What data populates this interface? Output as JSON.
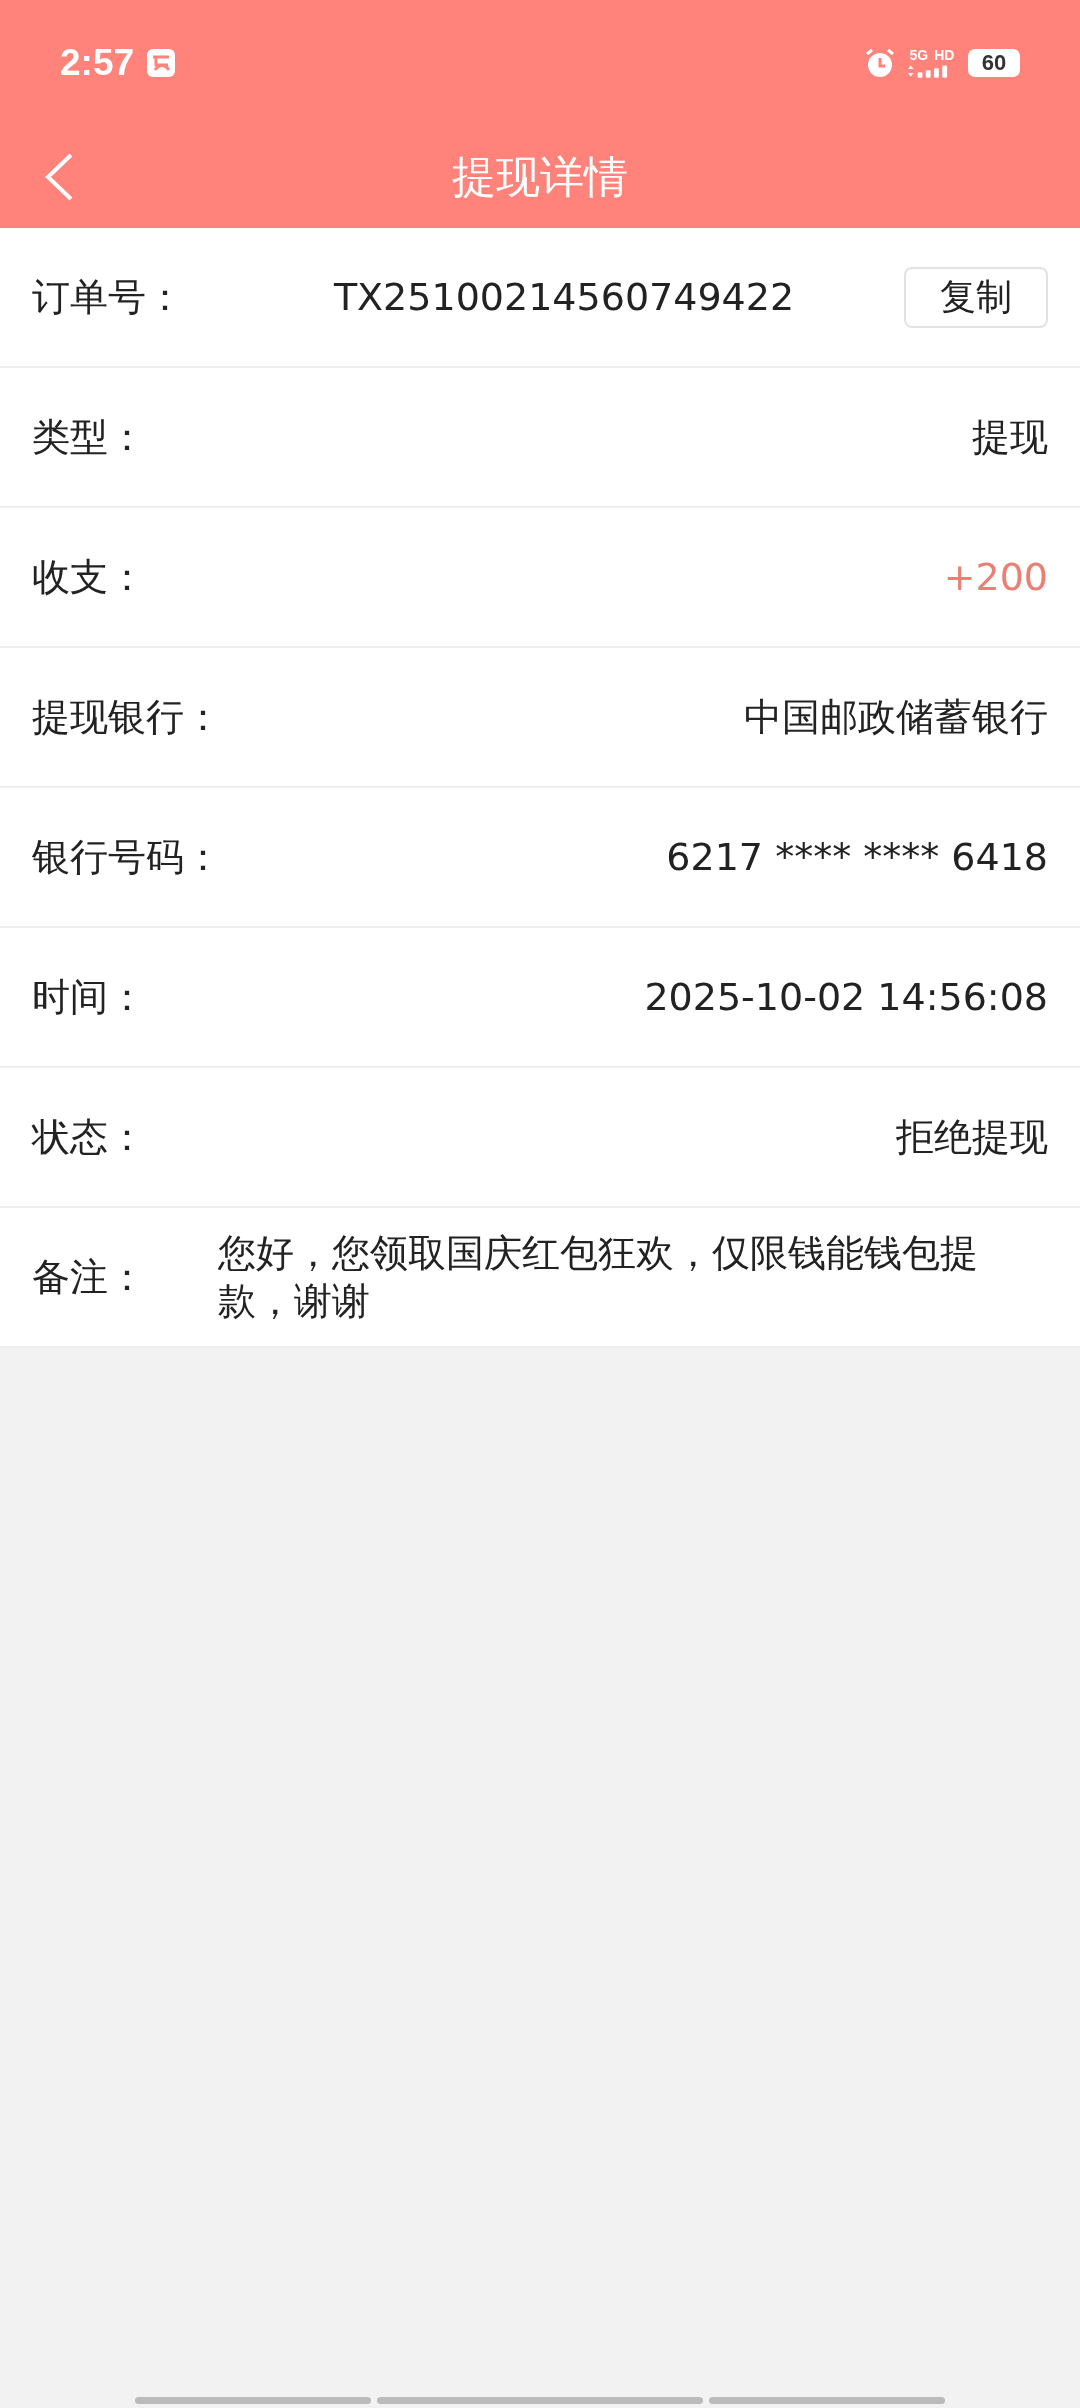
{
  "status_bar": {
    "time": "2:57",
    "network": "5G",
    "network_extra": "HD",
    "battery": "60"
  },
  "header": {
    "title": "提现详情"
  },
  "rows": [
    {
      "kind": "order",
      "label": "订单号：",
      "value": "TX25100214560749422",
      "button": "复制"
    },
    {
      "kind": "plain",
      "label": "类型：",
      "value": "提现"
    },
    {
      "kind": "amount",
      "label": "收支：",
      "value": "+200"
    },
    {
      "kind": "plain",
      "label": "提现银行：",
      "value": "中国邮政储蓄银行"
    },
    {
      "kind": "plain",
      "label": "银行号码：",
      "value": "6217 **** **** 6418"
    },
    {
      "kind": "plain",
      "label": "时间：",
      "value": "2025-10-02 14:56:08"
    },
    {
      "kind": "plain",
      "label": "状态：",
      "value": "拒绝提现"
    },
    {
      "kind": "note",
      "label": "备注：",
      "value": "您好，您领取国庆红包狂欢，仅限钱能钱包提款，谢谢"
    }
  ]
}
